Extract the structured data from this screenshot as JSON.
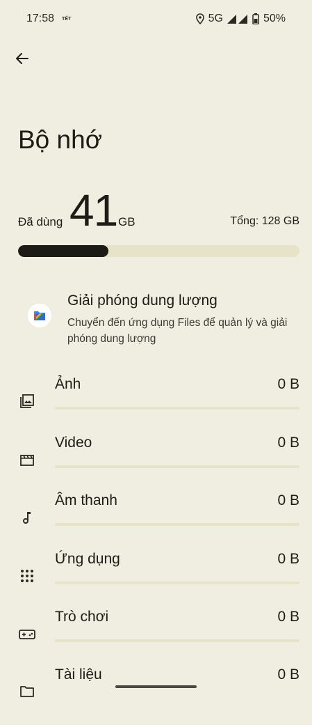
{
  "status_bar": {
    "time": "17:58",
    "carrier": "TẾT",
    "network": "5G",
    "battery": "50%"
  },
  "header": {
    "back_icon": "arrow-back-icon"
  },
  "page": {
    "title": "Bộ nhớ"
  },
  "storage": {
    "used_label": "Đã dùng",
    "used_value": "41",
    "used_unit": "GB",
    "total_label": "Tổng: 128 GB",
    "used_fraction": 0.32
  },
  "free_up": {
    "icon": "files-app-icon",
    "title": "Giải phóng dung lượng",
    "subtitle": "Chuyển đến ứng dụng Files để quản lý và giải phóng dung lượng"
  },
  "categories": [
    {
      "icon": "photo-icon",
      "label": "Ảnh",
      "size": "0 B"
    },
    {
      "icon": "video-icon",
      "label": "Video",
      "size": "0 B"
    },
    {
      "icon": "music-note-icon",
      "label": "Âm thanh",
      "size": "0 B"
    },
    {
      "icon": "apps-grid-icon",
      "label": "Ứng dụng",
      "size": "0 B"
    },
    {
      "icon": "gamepad-icon",
      "label": "Trò chơi",
      "size": "0 B"
    },
    {
      "icon": "folder-icon",
      "label": "Tài liệu",
      "size": "0 B"
    }
  ],
  "colors": {
    "background": "#f0eee0",
    "bar_fill": "#1c1b15",
    "bar_track": "#e6e3c9"
  }
}
